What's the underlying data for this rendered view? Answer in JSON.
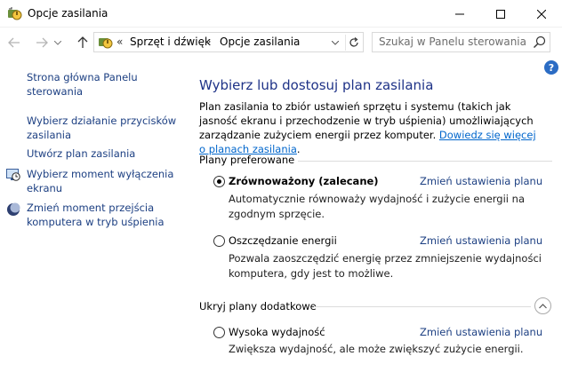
{
  "window": {
    "title": "Opcje zasilania",
    "title_icon": "power-options-icon"
  },
  "titlebar_buttons": {
    "minimize_icon": "minimize-icon",
    "maximize_icon": "maximize-icon",
    "close_icon": "close-icon"
  },
  "address": {
    "breadcrumb_prefix": "«",
    "crumb1": "Sprzęt i dźwięk",
    "separator": "›",
    "crumb2": "Opcje zasilania"
  },
  "search": {
    "placeholder": "Szukaj w Panelu sterowania"
  },
  "help": {
    "label": "?"
  },
  "sidebar": {
    "items": [
      {
        "label": "Strona główna Panelu sterowania"
      },
      {
        "label": "Wybierz działanie przycisków zasilania"
      },
      {
        "label": "Utwórz plan zasilania"
      },
      {
        "label": "Wybierz moment wyłączenia ekranu",
        "icon": "monitor-clock-icon"
      },
      {
        "label": "Zmień moment przejścia komputera w tryb uśpienia",
        "icon": "moon-icon"
      }
    ]
  },
  "main": {
    "title": "Wybierz lub dostosuj plan zasilania",
    "description": "Plan zasilania to zbiór ustawień sprzętu i systemu (takich jak jasność ekranu i przechodzenie w tryb uśpienia) umożliwiających zarządzanie zużyciem energii przez komputer. ",
    "description_link": "Dowiedz się więcej o planach zasilania",
    "description_end": "."
  },
  "groups": {
    "preferred": {
      "header": "Plany preferowane",
      "plans": [
        {
          "name": "Zrównoważony (zalecane)",
          "selected": true,
          "link": "Zmień ustawienia planu",
          "desc": "Automatycznie równoważy wydajność i zużycie energii na zgodnym sprzęcie."
        },
        {
          "name": "Oszczędzanie energii",
          "selected": false,
          "link": "Zmień ustawienia planu",
          "desc": "Pozwala zaoszczędzić energię przez zmniejszenie wydajności komputera, gdy jest to możliwe."
        }
      ]
    },
    "additional": {
      "header": "Ukryj plany dodatkowe",
      "plans": [
        {
          "name": "Wysoka wydajność",
          "selected": false,
          "link": "Zmień ustawienia planu",
          "desc": "Zwiększa wydajność, ale może zwiększyć zużycie energii."
        }
      ]
    }
  }
}
